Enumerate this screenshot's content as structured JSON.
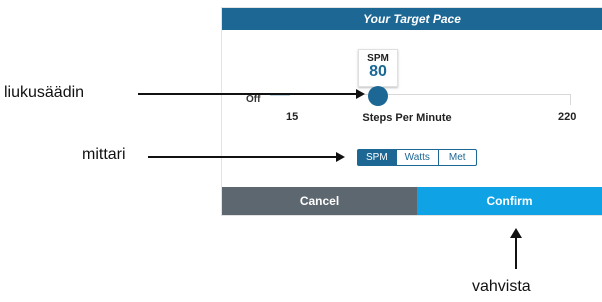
{
  "dialog": {
    "title": "Your Target Pace",
    "tooltip": {
      "unit": "SPM",
      "value": "80"
    },
    "slider": {
      "off_label": "Off",
      "min_label": "15",
      "max_label": "220",
      "caption": "Steps Per Minute",
      "min": 15,
      "max": 220,
      "value": 80
    },
    "metric_toggle": {
      "options": [
        "SPM",
        "Watts",
        "Met"
      ],
      "selected": "SPM"
    },
    "buttons": {
      "cancel": "Cancel",
      "confirm": "Confirm"
    }
  },
  "annotations": {
    "slider": "liukusäädin",
    "meter": "mittari",
    "confirm": "vahvista"
  },
  "colors": {
    "header": "#1c6794",
    "accent": "#1c6794",
    "cancel_bg": "#5d6770",
    "confirm_bg": "#0fa3e6"
  }
}
